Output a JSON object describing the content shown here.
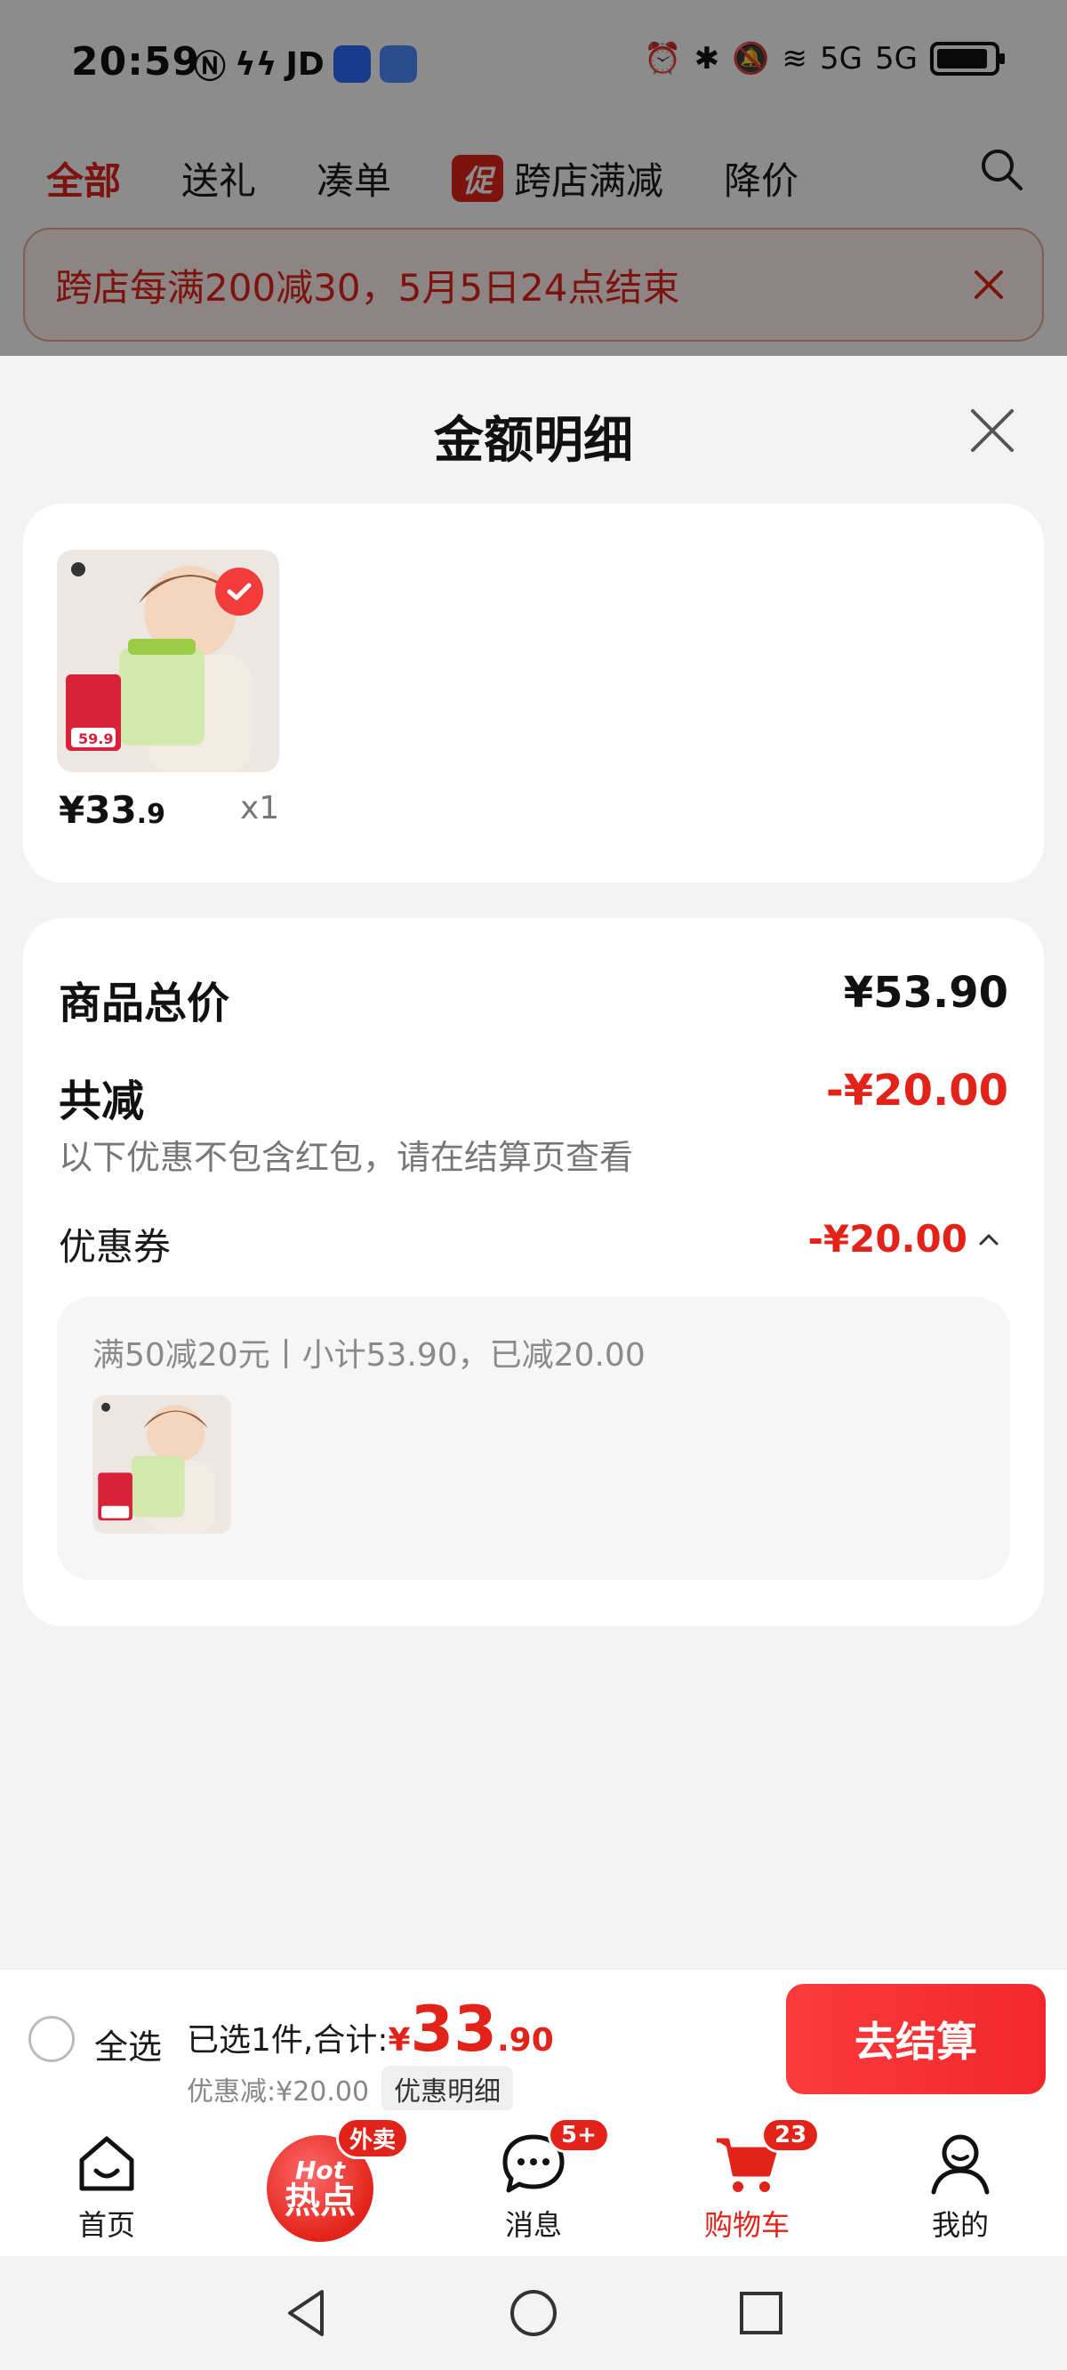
{
  "status_bar": {
    "time": "20:59",
    "carrier_badge": "JD",
    "network": "5G"
  },
  "top_tabs": {
    "items": [
      {
        "label": "全部",
        "active": true
      },
      {
        "label": "送礼",
        "active": false
      },
      {
        "label": "凑单",
        "active": false
      },
      {
        "label": "跨店满减",
        "active": false,
        "chip": "促"
      },
      {
        "label": "降价",
        "active": false
      }
    ]
  },
  "promo_banner": {
    "text": "跨店每满200减30，5月5日24点结束"
  },
  "sheet": {
    "title": "金额明细"
  },
  "item": {
    "price_int": "¥33",
    "price_dec": ".9",
    "qty": "x1"
  },
  "summary": {
    "total_label": "商品总价",
    "total_value": "¥53.90",
    "discount_label": "共减",
    "discount_value": "-¥20.00",
    "note": "以下优惠不包含红包，请在结算页查看",
    "coupon_label": "优惠券",
    "coupon_value": "-¥20.00",
    "coupon_detail": "满50减20元丨小计53.90，已减20.00"
  },
  "checkout": {
    "select_all": "全选",
    "selected_text": "已选1件,合计:",
    "total_currency": "¥",
    "total_int": "33",
    "total_dec": ".90",
    "discount_text": "优惠减:¥20.00",
    "detail_chip": "优惠明细",
    "button": "去结算"
  },
  "bottom_nav": {
    "home": "首页",
    "hot_badge": "外卖",
    "hot_top": "Hot",
    "hot_bottom": "热点",
    "messages": "消息",
    "messages_badge": "5+",
    "cart": "购物车",
    "cart_badge": "23",
    "me": "我的"
  },
  "colors": {
    "accent": "#e2231a",
    "banner_bg": "#fff2f1"
  }
}
